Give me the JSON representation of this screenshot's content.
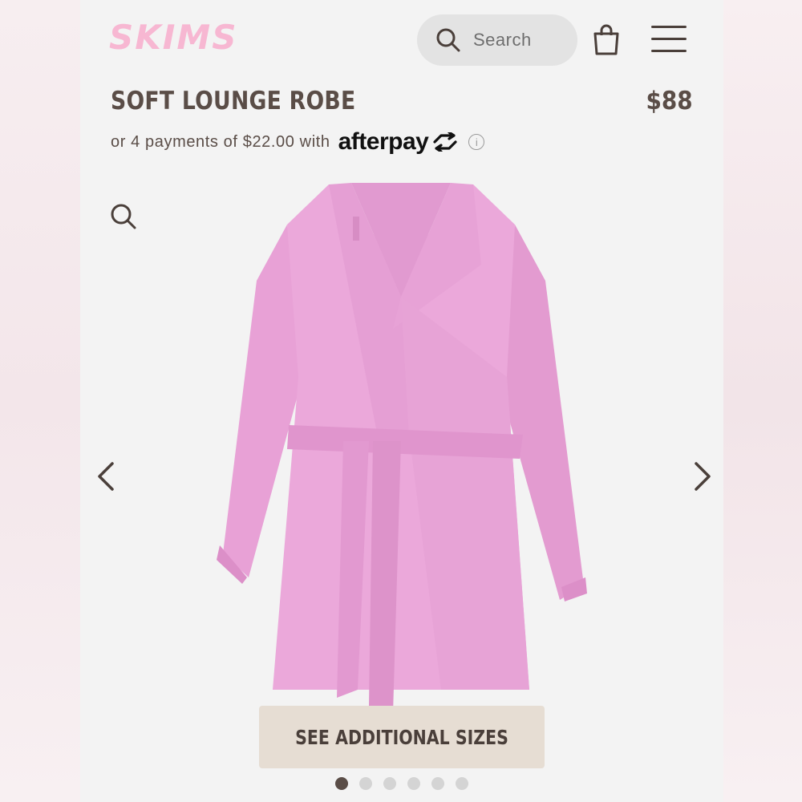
{
  "header": {
    "logo_text": "SKIMS",
    "search_label": "Search",
    "icons": [
      "search-icon",
      "shopping-bag-icon",
      "hamburger-menu-icon"
    ]
  },
  "product": {
    "title": "SOFT LOUNGE ROBE",
    "price": "$88",
    "installments_text": "or 4 payments of $22.00 with",
    "afterpay_brand": "afterpay",
    "image_alt": "Pink soft lounge robe with belt",
    "robe_color": "#e9a3d8"
  },
  "gallery": {
    "icons": [
      "zoom-icon",
      "chevron-left-icon",
      "chevron-right-icon"
    ],
    "dot_count": 6,
    "active_dot": 1
  },
  "cta": {
    "see_sizes_label": "SEE ADDITIONAL SIZES"
  },
  "colors": {
    "logo_pink": "#f7b7d2",
    "text_brown": "#5a4d47",
    "button_beige": "#e6ddd3",
    "page_bg": "#f3f3f3"
  }
}
